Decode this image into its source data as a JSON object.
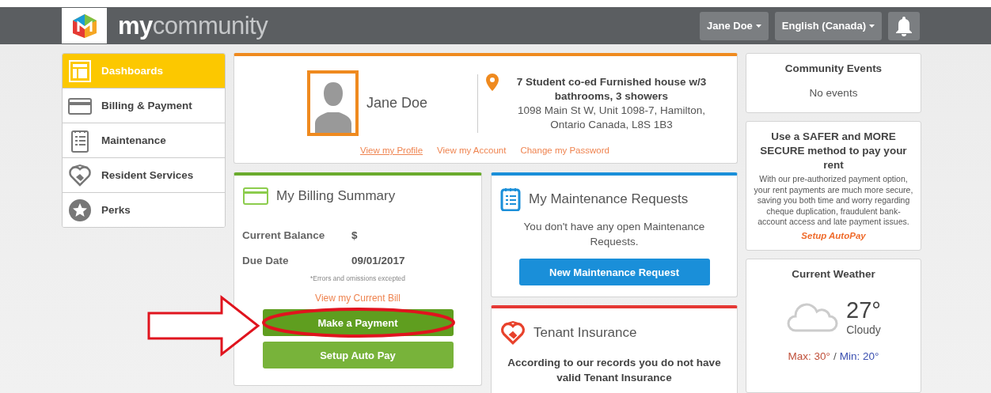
{
  "header": {
    "brand_bold": "my",
    "brand_light": "community",
    "user_menu": "Jane Doe",
    "language_menu": "English (Canada)"
  },
  "sidebar": {
    "items": [
      {
        "label": "Dashboards",
        "kind": "layout",
        "selected": true
      },
      {
        "label": "Billing & Payment",
        "kind": "card",
        "selected": false
      },
      {
        "label": "Maintenance",
        "kind": "clipboard",
        "selected": false
      },
      {
        "label": "Resident Services",
        "kind": "heart",
        "selected": false
      },
      {
        "label": "Perks",
        "kind": "star",
        "selected": false
      }
    ]
  },
  "profile": {
    "name": "Jane Doe",
    "property": "7 Student co-ed Furnished house w/3 bathrooms, 3 showers",
    "address": "1098 Main St W, Unit 1098-7, Hamilton, Ontario Canada, L8S 1B3",
    "links": [
      {
        "label": "View my Profile",
        "selected": true
      },
      {
        "label": "View my Account",
        "selected": false
      },
      {
        "label": "Change my Password",
        "selected": false
      }
    ]
  },
  "billing": {
    "title": "My Billing Summary",
    "rows": [
      {
        "label": "Current Balance",
        "value": "$"
      },
      {
        "label": "Due Date",
        "value": "09/01/2017"
      }
    ],
    "note": "*Errors and omissions excepted",
    "bill_link": "View my Current Bill",
    "buttons": [
      {
        "label": "Make a Payment",
        "highlighted": true
      },
      {
        "label": "Setup Auto Pay",
        "highlighted": false
      }
    ]
  },
  "maintenance": {
    "title": "My Maintenance Requests",
    "message": "You don't have any open Maintenance Requests.",
    "button": "New Maintenance Request"
  },
  "insurance": {
    "title": "Tenant Insurance",
    "message": "According to our records you do not have valid Tenant Insurance"
  },
  "events": {
    "title": "Community Events",
    "message": "No events"
  },
  "autopay": {
    "title": "Use a SAFER and MORE SECURE method to pay your rent",
    "body": "With our pre-authorized payment option, your rent payments are much more secure, saving you both time and worry regarding cheque duplication, fraudulent bank-account access and late payment issues.",
    "link": "Setup AutoPay"
  },
  "weather": {
    "title": "Current Weather",
    "temperature": "27°",
    "condition": "Cloudy",
    "max": "Max: 30°",
    "separator": "/",
    "min": "Min: 20°"
  }
}
